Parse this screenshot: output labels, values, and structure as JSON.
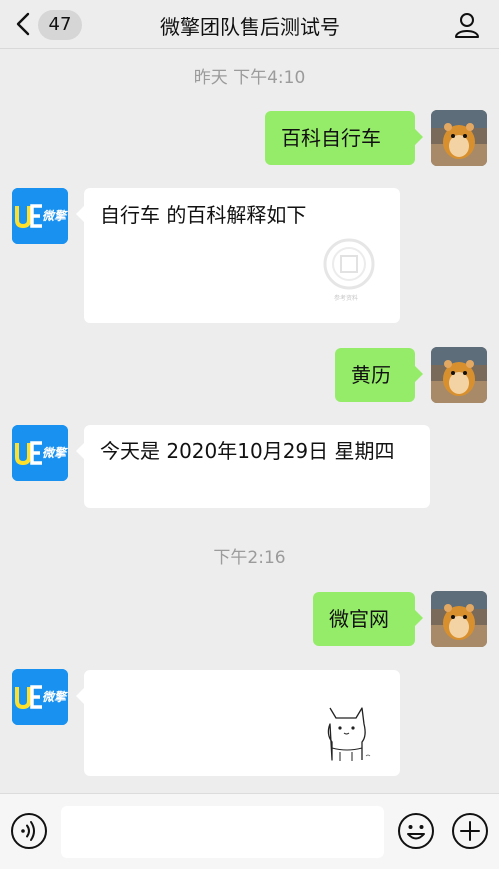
{
  "header": {
    "back_icon": "chevron-left-icon",
    "unread_count": "47",
    "title": "微擎团队售后测试号",
    "profile_icon": "person-icon"
  },
  "bot": {
    "logo_text": "微擎",
    "brand_color": "#1891f0"
  },
  "colors": {
    "background": "#ededed",
    "sent_bubble": "#95ec69",
    "received_bubble": "#ffffff",
    "timestamp": "#9b9b9b"
  },
  "messages": [
    {
      "type": "time",
      "text": "昨天 下午4:10"
    },
    {
      "type": "sent",
      "text": "百科自行车"
    },
    {
      "type": "received",
      "text": "自行车 的百科解释如下",
      "image": "watermark-placeholder",
      "caption": "参考资料"
    },
    {
      "type": "sent",
      "text": "黄历"
    },
    {
      "type": "received",
      "text": "今天是 2020年10月29日 星期四"
    },
    {
      "type": "time",
      "text": "下午2:16"
    },
    {
      "type": "sent",
      "text": "微官网"
    },
    {
      "type": "received",
      "text": "",
      "image": "cat-sticker"
    }
  ],
  "input_bar": {
    "voice_icon": "voice-icon",
    "input_value": "",
    "emoji_icon": "emoji-icon",
    "plus_icon": "plus-icon"
  }
}
